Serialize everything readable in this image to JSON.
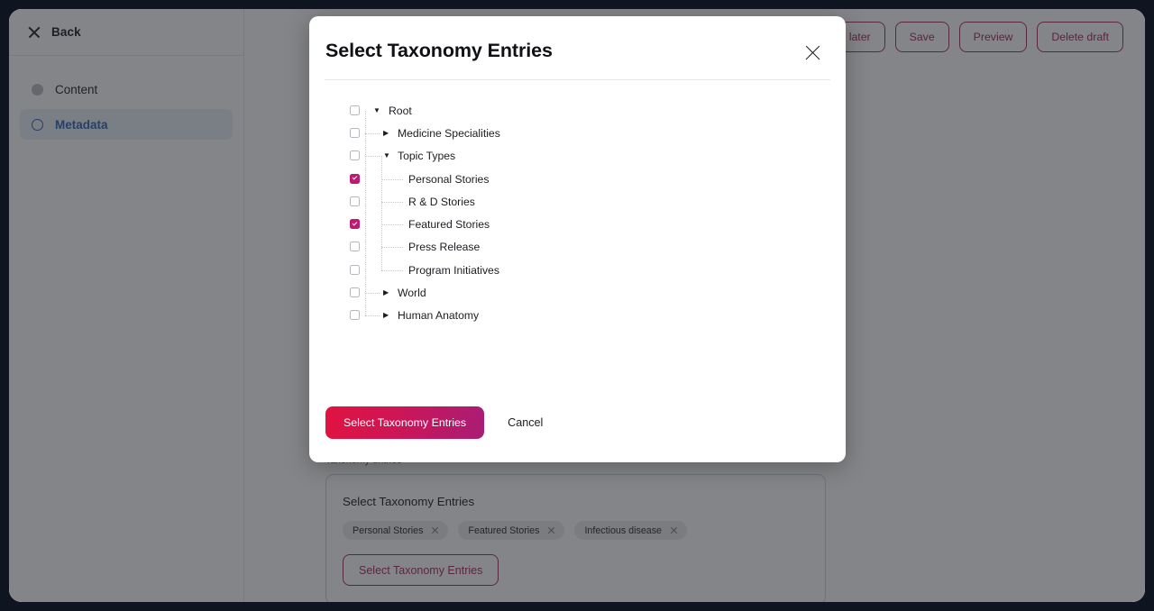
{
  "sidebar": {
    "back_label": "Back",
    "items": [
      {
        "label": "Content",
        "icon": "filled-circle-icon",
        "active": false
      },
      {
        "label": "Metadata",
        "icon": "ring-circle-icon",
        "active": true
      }
    ]
  },
  "toolbar": {
    "buttons": [
      {
        "label": "Publish later"
      },
      {
        "label": "Save"
      },
      {
        "label": "Preview"
      },
      {
        "label": "Delete draft"
      }
    ]
  },
  "taxonomy_section": {
    "field_label": "Taxonomy entries",
    "card_title": "Select Taxonomy Entries",
    "chips": [
      {
        "label": "Personal Stories"
      },
      {
        "label": "Featured Stories"
      },
      {
        "label": "Infectious disease"
      }
    ],
    "button_label": "Select Taxonomy Entries"
  },
  "modal": {
    "title": "Select Taxonomy Entries",
    "close_icon": "close-icon",
    "tree": [
      {
        "label": "Root",
        "depth": 0,
        "checked": false,
        "caret": "down",
        "row": 0
      },
      {
        "label": "Medicine Specialities",
        "depth": 1,
        "checked": false,
        "caret": "right",
        "row": 1
      },
      {
        "label": "Topic Types",
        "depth": 1,
        "checked": false,
        "caret": "down",
        "row": 2
      },
      {
        "label": "Personal Stories",
        "depth": 2,
        "checked": true,
        "caret": "none",
        "row": 3
      },
      {
        "label": "R & D Stories",
        "depth": 2,
        "checked": false,
        "caret": "none",
        "row": 4
      },
      {
        "label": "Featured Stories",
        "depth": 2,
        "checked": true,
        "caret": "none",
        "row": 5
      },
      {
        "label": "Press Release",
        "depth": 2,
        "checked": false,
        "caret": "none",
        "row": 6
      },
      {
        "label": "Program Initiatives",
        "depth": 2,
        "checked": false,
        "caret": "none",
        "row": 7
      },
      {
        "label": "World",
        "depth": 1,
        "checked": false,
        "caret": "right",
        "row": 8
      },
      {
        "label": "Human Anatomy",
        "depth": 1,
        "checked": false,
        "caret": "right",
        "row": 9
      }
    ],
    "confirm_label": "Select Taxonomy Entries",
    "cancel_label": "Cancel"
  },
  "colors": {
    "accent_magenta": "#bb1b72",
    "accent_crimson": "#e11340",
    "outline_maroon": "#a2295c",
    "active_blue": "#2d62b4"
  }
}
